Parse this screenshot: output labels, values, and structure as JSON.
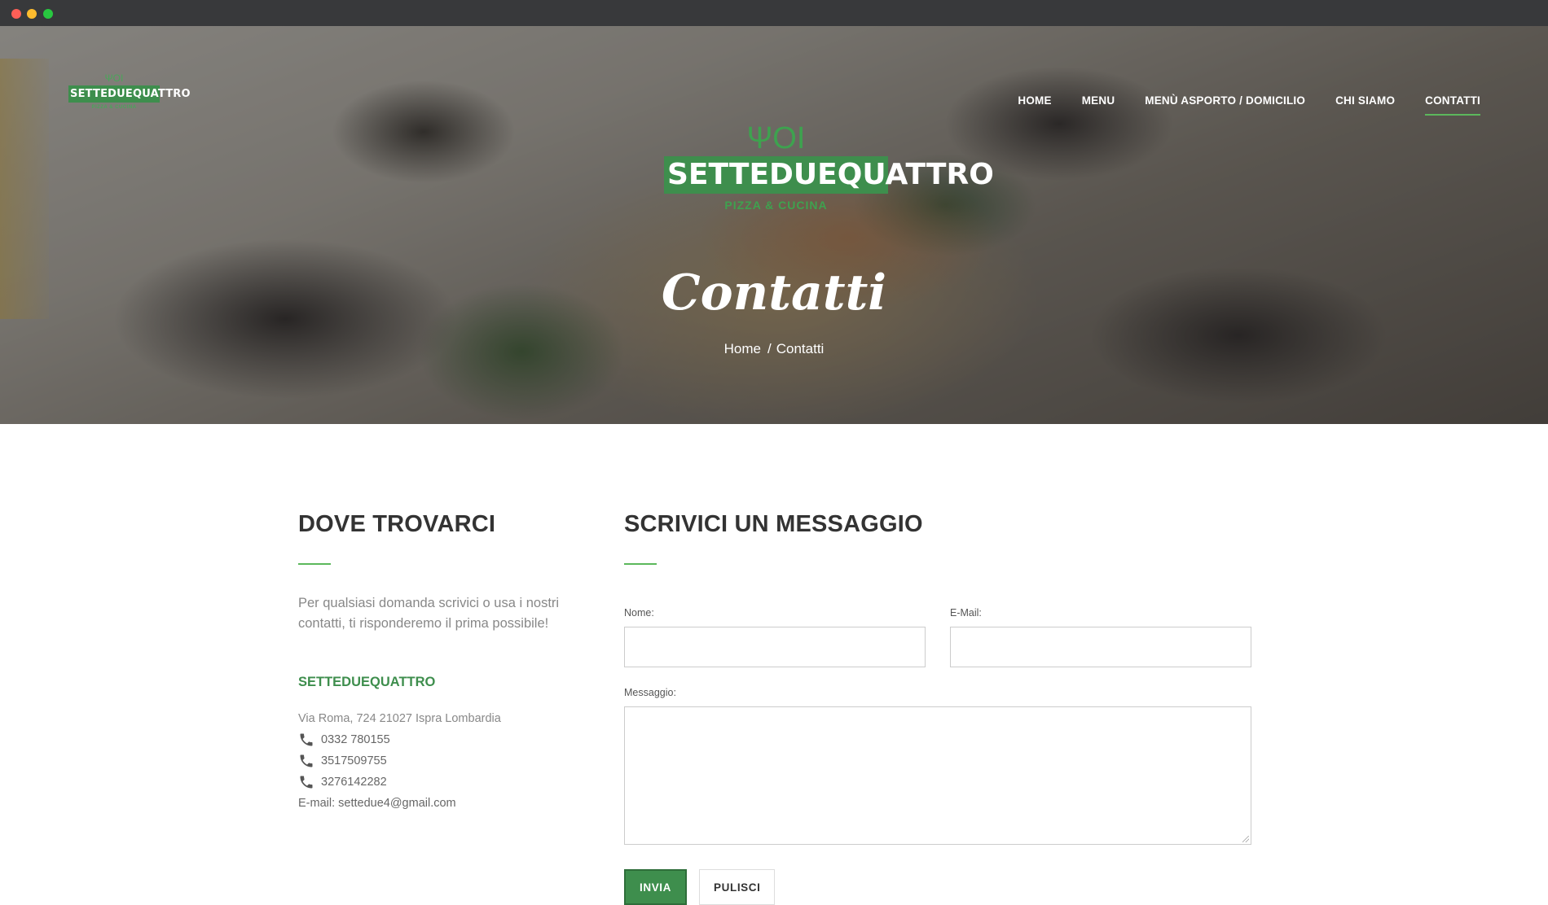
{
  "brand": {
    "name": "SETTEDUEQUATTRO",
    "tagline": "PIZZA & CUCINA",
    "accent_color": "#3e8e4d"
  },
  "nav": {
    "items": [
      {
        "label": "HOME"
      },
      {
        "label": "MENU"
      },
      {
        "label": "MENÙ ASPORTO / DOMICILIO"
      },
      {
        "label": "CHI SIAMO"
      },
      {
        "label": "CONTATTI",
        "active": true
      }
    ]
  },
  "hero": {
    "title": "Contatti",
    "breadcrumb": {
      "home": "Home",
      "separator": "/",
      "current": "Contatti"
    }
  },
  "contact_info": {
    "title": "DOVE TROVARCI",
    "intro": "Per qualsiasi domanda scrivici o usa i nostri contatti, ti risponderemo il prima possibile!",
    "company": "SETTEDUEQUATTRO",
    "address": "Via Roma, 724 21027 Ispra Lombardia",
    "phones": [
      "0332 780155",
      "3517509755",
      "3276142282"
    ],
    "email": "E-mail: settedue4@gmail.com"
  },
  "form": {
    "title": "SCRIVICI UN MESSAGGIO",
    "name_label": "Nome:",
    "name_value": "",
    "email_label": "E-Mail:",
    "email_value": "",
    "message_label": "Messaggio:",
    "message_value": "",
    "submit_label": "INVIA",
    "reset_label": "PULISCI"
  }
}
